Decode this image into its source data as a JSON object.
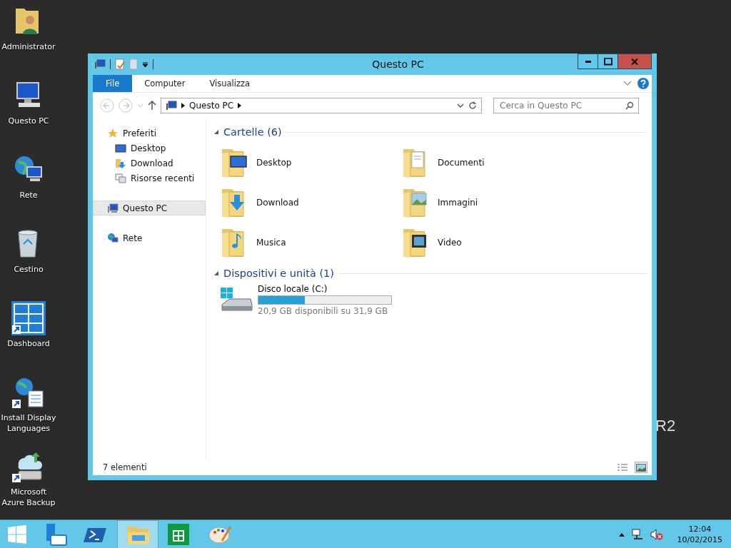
{
  "desktop_icons": [
    {
      "kind": "user",
      "label": "Administrator"
    },
    {
      "kind": "computer",
      "label": "Questo PC"
    },
    {
      "kind": "network",
      "label": "Rete"
    },
    {
      "kind": "bin",
      "label": "Cestino"
    },
    {
      "kind": "dashboard",
      "label": "Dashboard"
    },
    {
      "kind": "languages",
      "label": "Install Display Languages"
    },
    {
      "kind": "backup",
      "label": "Microsoft Azure Backup"
    }
  ],
  "wallpaper_text": "R2",
  "window": {
    "title": "Questo PC"
  },
  "ribbon": {
    "tabs": [
      {
        "label": "File",
        "selected": true
      },
      {
        "label": "Computer",
        "selected": false
      },
      {
        "label": "Visualizza",
        "selected": false
      }
    ]
  },
  "address_bar": {
    "path": "Questo PC",
    "search": {
      "placeholder": "Cerca in Questo PC"
    }
  },
  "navigation": [
    {
      "kind": "favorites",
      "label": "Preferiti",
      "selected": false,
      "children": [
        {
          "kind": "desktop",
          "label": "Desktop",
          "selected": false
        },
        {
          "kind": "download",
          "label": "Download",
          "selected": false
        },
        {
          "kind": "recent",
          "label": "Risorse recenti",
          "selected": false
        }
      ]
    },
    {
      "kind": "computer",
      "label": "Questo PC",
      "selected": true
    },
    {
      "kind": "network",
      "label": "Rete",
      "selected": false
    }
  ],
  "sections": [
    {
      "title": "Cartelle (6)",
      "expanded": true,
      "folders": [
        {
          "kind": "desktop",
          "label": "Desktop"
        },
        {
          "kind": "documents",
          "label": "Documenti"
        },
        {
          "kind": "download",
          "label": "Download"
        },
        {
          "kind": "pictures",
          "label": "Immagini"
        },
        {
          "kind": "music",
          "label": "Musica"
        },
        {
          "kind": "video",
          "label": "Video"
        }
      ]
    },
    {
      "title": "Dispositivi e unità (1)",
      "expanded": true,
      "drives": [
        {
          "name": "Disco locale (C:)",
          "level": 0.35,
          "space": "20,9 GB disponibili su 31,9 GB"
        }
      ]
    }
  ],
  "status_bar": {
    "count": "7 elementi",
    "views": [
      {
        "kind": "details",
        "selected": false
      },
      {
        "kind": "large-icons",
        "selected": true
      }
    ]
  },
  "taskbar": {
    "apps": [
      {
        "kind": "server-manager",
        "selected": false
      },
      {
        "kind": "powershell",
        "selected": false
      },
      {
        "kind": "explorer",
        "selected": true
      },
      {
        "kind": "store",
        "selected": false
      },
      {
        "kind": "paint",
        "selected": false
      }
    ],
    "time": "12:04",
    "date": "10/02/2015"
  }
}
